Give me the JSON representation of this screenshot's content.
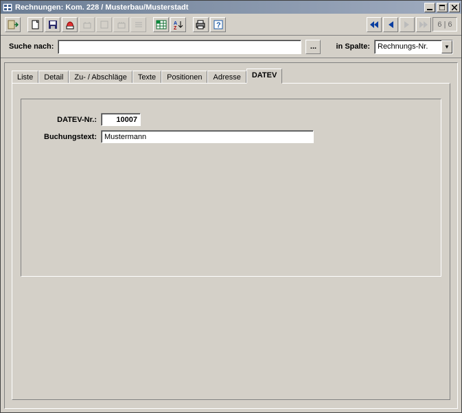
{
  "window": {
    "title": "Rechnungen: Kom. 228 / Musterbau/Musterstadt"
  },
  "nav": {
    "counter": "6 | 6"
  },
  "search": {
    "label": "Suche nach:",
    "value": "",
    "placeholder": "",
    "dots": "...",
    "in_spalte_label": "in Spalte:",
    "column_selected": "Rechnungs-Nr."
  },
  "tabs": {
    "items": [
      {
        "label": "Liste"
      },
      {
        "label": "Detail"
      },
      {
        "label": "Zu- / Abschläge"
      },
      {
        "label": "Texte"
      },
      {
        "label": "Positionen"
      },
      {
        "label": "Adresse"
      },
      {
        "label": "DATEV"
      }
    ],
    "active_index": 6
  },
  "form": {
    "datev_nr_label": "DATEV-Nr.:",
    "datev_nr_value": "10007",
    "buchungstext_label": "Buchungstext:",
    "buchungstext_value": "Mustermann"
  }
}
